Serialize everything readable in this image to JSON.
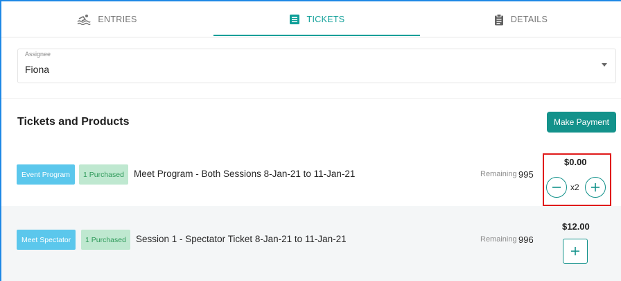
{
  "tabs": [
    {
      "label": "ENTRIES",
      "icon": "swimming-icon"
    },
    {
      "label": "TICKETS",
      "icon": "ticket-list-icon",
      "active": true
    },
    {
      "label": "DETAILS",
      "icon": "clipboard-icon"
    }
  ],
  "assignee": {
    "label": "Assignee",
    "value": "Fiona"
  },
  "section": {
    "title": "Tickets and Products",
    "pay_button": "Make Payment"
  },
  "items": [
    {
      "category": "Event Program",
      "status": "1 Purchased",
      "title": "Meet Program - Both Sessions 8-Jan-21 to 11-Jan-21",
      "remaining_label": "Remaining",
      "remaining": "995",
      "price": "$0.00",
      "quantity": "x2"
    },
    {
      "category": "Meet Spectator",
      "status": "1 Purchased",
      "title": "Session 1 - Spectator Ticket 8-Jan-21 to 11-Jan-21",
      "remaining_label": "Remaining",
      "remaining": "996",
      "price": "$12.00"
    }
  ],
  "colors": {
    "accent": "#13928b",
    "tab_active": "#0e9f98",
    "badge_blue": "#5bc7ec",
    "badge_green": "#bfe8d0",
    "highlight": "#e01b1b"
  }
}
